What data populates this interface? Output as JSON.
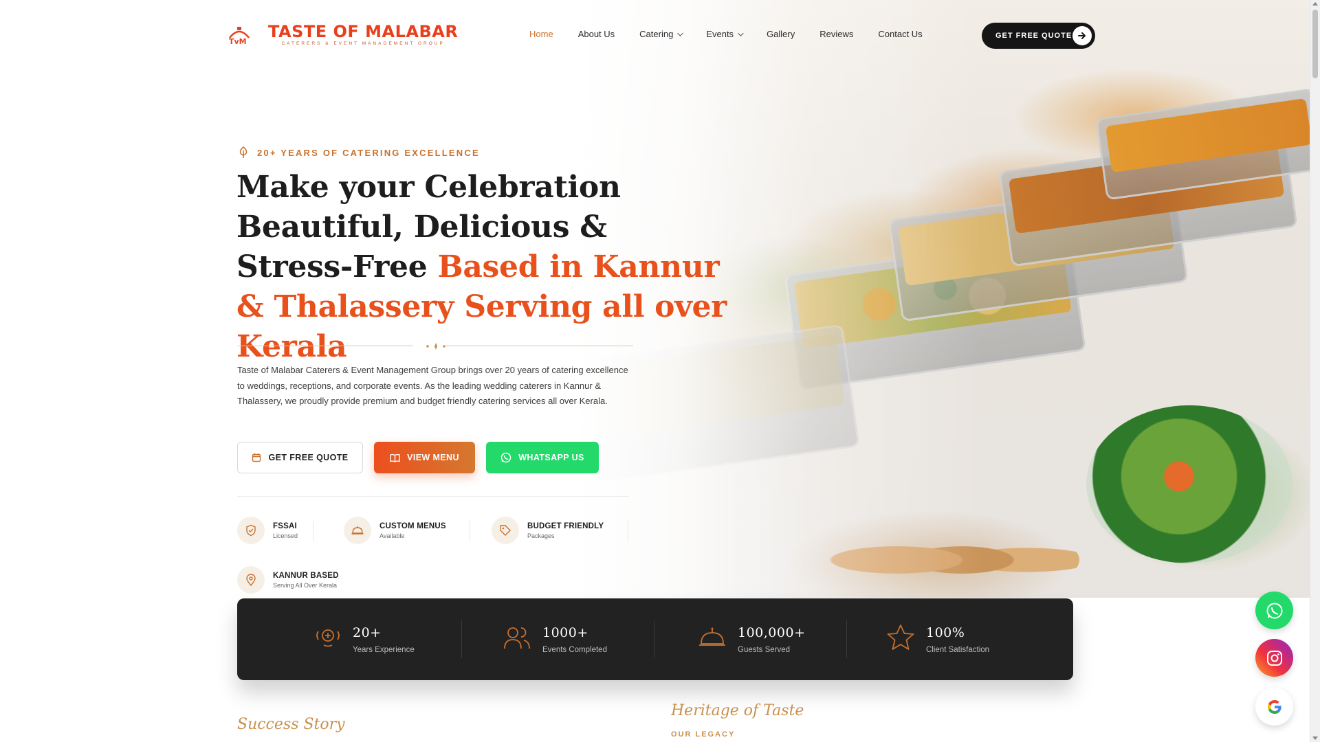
{
  "brand": {
    "name": "TASTE OF MALABAR",
    "subtitle": "CATERERS & EVENT MANAGEMENT GROUP",
    "primary_color": "#e8401c",
    "accent_color": "#c9712d"
  },
  "nav": {
    "items": [
      {
        "label": "Home",
        "active": true,
        "dropdown": false
      },
      {
        "label": "About Us",
        "active": false,
        "dropdown": false
      },
      {
        "label": "Catering",
        "active": false,
        "dropdown": true
      },
      {
        "label": "Events",
        "active": false,
        "dropdown": true
      },
      {
        "label": "Gallery",
        "active": false,
        "dropdown": false
      },
      {
        "label": "Reviews",
        "active": false,
        "dropdown": false
      },
      {
        "label": "Contact Us",
        "active": false,
        "dropdown": false
      }
    ],
    "cta_label": "GET FREE QUOTE"
  },
  "hero": {
    "tagline": "20+ YEARS OF CATERING EXCELLENCE",
    "headline_dark": "Make your Celebration Beautiful, Delicious & Stress-Free",
    "headline_accent": "Based in Kannur & Thalassery Serving all over Kerala",
    "intro": "Taste of Malabar Caterers & Event Management Group brings over 20 years of catering excellence to weddings, receptions, and corporate events. As the leading wedding caterers in Kannur & Thalassery, we proudly provide premium and budget friendly catering services all over Kerala.",
    "buttons": {
      "quote": "GET FREE QUOTE",
      "menu": "VIEW MENU",
      "whatsapp": "WHATSAPP US"
    }
  },
  "features": [
    {
      "title": "FSSAI",
      "subtitle": "Licensed",
      "icon": "shield-check-icon"
    },
    {
      "title": "CUSTOM MENUS",
      "subtitle": "Available",
      "icon": "cloche-icon"
    },
    {
      "title": "BUDGET FRIENDLY",
      "subtitle": "Packages",
      "icon": "tag-icon"
    },
    {
      "title": "KANNUR BASED",
      "subtitle": "Serving All Over Kerala",
      "icon": "map-pin-icon"
    }
  ],
  "stats": [
    {
      "value": "20+",
      "label": "Years Experience",
      "icon": "award-icon"
    },
    {
      "value": "1000+",
      "label": "Events Completed",
      "icon": "users-icon"
    },
    {
      "value": "100,000+",
      "label": "Guests Served",
      "icon": "cloche-icon"
    },
    {
      "value": "100%",
      "label": "Client Satisfaction",
      "icon": "star-icon"
    }
  ],
  "sections": {
    "left_title": "Success Story",
    "right_title": "Heritage of Taste",
    "right_subtitle": "OUR LEGACY"
  },
  "floating": {
    "whatsapp_color": "#22d96a",
    "icons": [
      "whatsapp-icon",
      "instagram-icon",
      "google-icon"
    ]
  }
}
